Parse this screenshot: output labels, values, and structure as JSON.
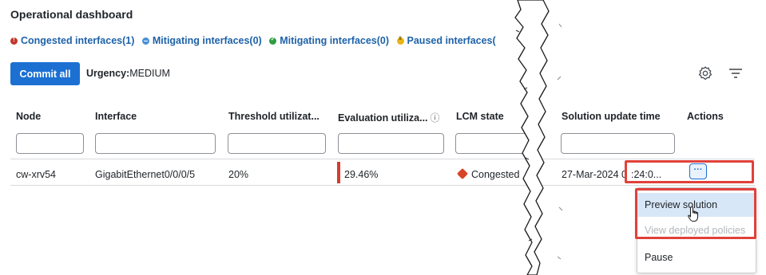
{
  "page": {
    "title": "Operational dashboard"
  },
  "filters": [
    {
      "label": "Congested interfaces(1)",
      "icon": "alert-icon",
      "color": "#c0392b"
    },
    {
      "label": "Mitigating interfaces(0)",
      "icon": "mitigating-icon",
      "color": "#4a90d9"
    },
    {
      "label": "Mitigating interfaces(0)",
      "icon": "check-icon",
      "color": "#2e9c43"
    },
    {
      "label": "Paused interfaces(",
      "icon": "pause-icon",
      "color": "#e8b416"
    }
  ],
  "toolbar": {
    "commit_label": "Commit all",
    "urgency_label": "Urgency:",
    "urgency_value": "MEDIUM",
    "settings_icon": "gear-icon",
    "filter_icon": "filter-lines-icon"
  },
  "table": {
    "columns": [
      "Node",
      "Interface",
      "Threshold utilizat...",
      "Evaluation utiliza...",
      "LCM state",
      "Solution update time",
      "Actions"
    ],
    "rows": [
      {
        "node": "cw-xrv54",
        "interface": "GigabitEthernet0/0/0/5",
        "threshold": "20%",
        "evaluation": "29.46%",
        "lcm_state": "Congested",
        "update_time_prefix": "27-Mar-2024 0",
        "update_time_suffix": ":24:0...",
        "actions_label": "···"
      }
    ]
  },
  "menu": {
    "items": [
      {
        "label": "Preview solution",
        "state": "hovered"
      },
      {
        "label": "View deployed policies",
        "state": "disabled"
      },
      {
        "label": "Pause",
        "state": "enabled"
      }
    ]
  },
  "colors": {
    "accent": "#1c70d2",
    "link": "#1e62a8",
    "highlight": "#e0413a",
    "congested": "#d64526"
  }
}
